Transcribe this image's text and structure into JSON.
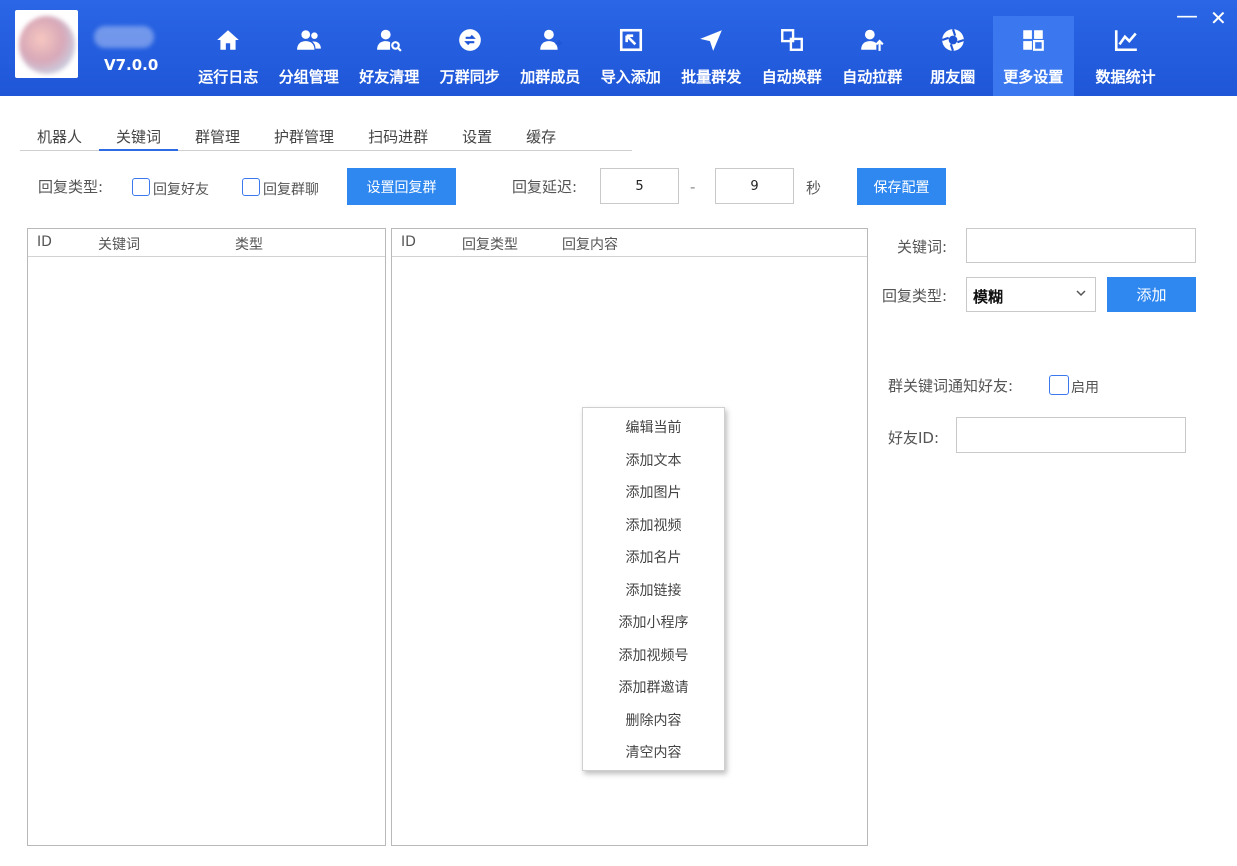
{
  "header": {
    "version": "V7.0.0",
    "nav": [
      {
        "label": "运行日志",
        "icon": "home-icon"
      },
      {
        "label": "分组管理",
        "icon": "users-icon"
      },
      {
        "label": "好友清理",
        "icon": "user-search-icon"
      },
      {
        "label": "万群同步",
        "icon": "sync-icon"
      },
      {
        "label": "加群成员",
        "icon": "user-add-icon"
      },
      {
        "label": "导入添加",
        "icon": "import-icon"
      },
      {
        "label": "批量群发",
        "icon": "send-icon"
      },
      {
        "label": "自动换群",
        "icon": "switch-icon"
      },
      {
        "label": "自动拉群",
        "icon": "user-up-icon"
      },
      {
        "label": "朋友圈",
        "icon": "aperture-icon"
      },
      {
        "label": "更多设置",
        "icon": "grid-icon"
      },
      {
        "label": "数据统计",
        "icon": "chart-line-icon"
      }
    ],
    "active_nav": "更多设置",
    "minimize": "—",
    "close": "✕"
  },
  "tabs": [
    "机器人",
    "关键词",
    "群管理",
    "护群管理",
    "扫码进群",
    "设置",
    "缓存"
  ],
  "active_tab": "关键词",
  "options": {
    "reply_type_label": "回复类型:",
    "reply_friend": "回复好友",
    "reply_group": "回复群聊",
    "set_reply_group_button": "设置回复群",
    "delay_label": "回复延迟:",
    "delay_min": "5",
    "delay_sep": "-",
    "delay_max": "9",
    "delay_unit": "秒",
    "save_button": "保存配置"
  },
  "left_table": {
    "columns": [
      "ID",
      "关键词",
      "类型"
    ],
    "rows": []
  },
  "mid_table": {
    "columns": [
      "ID",
      "回复类型",
      "回复内容"
    ],
    "rows": []
  },
  "form": {
    "keyword_label": "关键词:",
    "keyword_value": "",
    "reply_type_label": "回复类型:",
    "reply_type_value": "模糊",
    "add_button": "添加",
    "notify_label": "群关键词通知好友:",
    "enable_label": "启用",
    "friend_id_label": "好友ID:",
    "friend_id_value": ""
  },
  "context_menu": [
    "编辑当前",
    "添加文本",
    "添加图片",
    "添加视频",
    "添加名片",
    "添加链接",
    "添加小程序",
    "添加视频号",
    "添加群邀请",
    "删除内容",
    "清空内容"
  ]
}
